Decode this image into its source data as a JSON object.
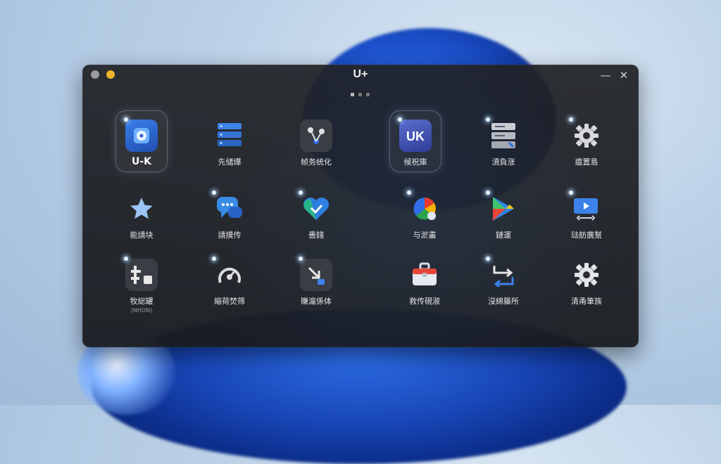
{
  "window": {
    "title": "U+",
    "min_glyph": "—",
    "close_glyph": "✕"
  },
  "apps": [
    {
      "label": "U-K",
      "icon": "disk-photo-icon"
    },
    {
      "label": "先储爆",
      "icon": "server-stack-icon"
    },
    {
      "label": "帧务统化",
      "icon": "share-nodes-icon"
    },
    {
      "label": "候祝庫",
      "icon": "uk-badge-icon"
    },
    {
      "label": "濆負涨",
      "icon": "server-rack-icon"
    },
    {
      "label": "瘟置島",
      "icon": "gear-icon"
    },
    {
      "label": "能請块",
      "icon": "star-icon"
    },
    {
      "label": "請摸传",
      "icon": "chat-bubbles-icon"
    },
    {
      "label": "嗇錢",
      "icon": "heart-check-icon"
    },
    {
      "label": "与淤畫",
      "icon": "color-wheel-icon"
    },
    {
      "label": "鏈運",
      "icon": "play-store-icon"
    },
    {
      "label": "琺舫廣幫",
      "icon": "video-screen-icon"
    },
    {
      "label": "牧総罐",
      "sub": "(NHON)",
      "icon": "tool-grid-icon"
    },
    {
      "label": "縮荷焚筛",
      "icon": "radar-icon"
    },
    {
      "label": "賺滬係体",
      "icon": "download-arrow-icon"
    },
    {
      "label": "救传硯淑",
      "icon": "toolbox-icon"
    },
    {
      "label": "沒綿籐所",
      "icon": "flow-arrows-icon"
    },
    {
      "label": "清甬筆族",
      "icon": "settings-gear-icon"
    }
  ]
}
